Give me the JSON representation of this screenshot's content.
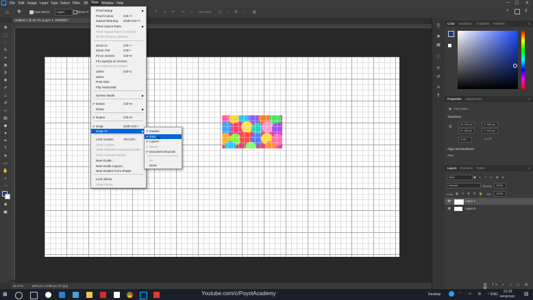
{
  "menubar": {
    "items": [
      "File",
      "Edit",
      "Image",
      "Layer",
      "Type",
      "Select",
      "Filter",
      "3D",
      "View",
      "Window",
      "Help"
    ],
    "window_controls": [
      "—",
      "☐",
      "✕"
    ]
  },
  "options": {
    "auto_select": "Auto-Select:",
    "layer_select": "Layer",
    "show_transform": "Show Tr",
    "mode_3d": "3D Mode:"
  },
  "document": {
    "tab_title": "Untitled-1 @ 66.7% (Layer 1, RGB/8#) *",
    "tab_close": "×"
  },
  "status": {
    "zoom": "66.67%",
    "doc_info": "1920 px x 1080 px (72 ppi)"
  },
  "view_menu": {
    "items": [
      {
        "label": "Proof Setup",
        "shortcut": "",
        "check": false,
        "disabled": false,
        "submenu": true
      },
      {
        "label": "Proof Colors",
        "shortcut": "Ctrl+Y",
        "check": false,
        "disabled": false,
        "submenu": false
      },
      {
        "label": "Gamut Warning",
        "shortcut": "Shift+Ctrl+Y",
        "check": false,
        "disabled": false,
        "submenu": false
      },
      {
        "label": "Pixel Aspect Ratio",
        "shortcut": "",
        "check": false,
        "disabled": false,
        "submenu": true
      },
      {
        "label": "Pixel Aspect Ratio Correction",
        "shortcut": "",
        "check": false,
        "disabled": true,
        "submenu": false
      },
      {
        "label": "32-bit Preview Options...",
        "shortcut": "",
        "check": false,
        "disabled": true,
        "submenu": false
      },
      {
        "label": "Zoom In",
        "shortcut": "Ctrl++",
        "check": false,
        "disabled": false,
        "submenu": false
      },
      {
        "label": "Zoom Out",
        "shortcut": "Ctrl+-",
        "check": false,
        "disabled": false,
        "submenu": false
      },
      {
        "label": "Fit on Screen",
        "shortcut": "Ctrl+0",
        "check": false,
        "disabled": false,
        "submenu": false
      },
      {
        "label": "Fit Layer(s) on Screen",
        "shortcut": "",
        "check": false,
        "disabled": false,
        "submenu": false
      },
      {
        "label": "Fit Artboard on Screen",
        "shortcut": "",
        "check": false,
        "disabled": true,
        "submenu": false
      },
      {
        "label": "100%",
        "shortcut": "Ctrl+1",
        "check": false,
        "disabled": false,
        "submenu": false
      },
      {
        "label": "200%",
        "shortcut": "",
        "check": false,
        "disabled": false,
        "submenu": false
      },
      {
        "label": "Print Size",
        "shortcut": "",
        "check": false,
        "disabled": false,
        "submenu": false
      },
      {
        "label": "Flip Horizontal",
        "shortcut": "",
        "check": false,
        "disabled": false,
        "submenu": false
      },
      {
        "label": "Screen Mode",
        "shortcut": "",
        "check": false,
        "disabled": false,
        "submenu": true
      },
      {
        "label": "Extras",
        "shortcut": "Ctrl+H",
        "check": true,
        "disabled": false,
        "submenu": false
      },
      {
        "label": "Show",
        "shortcut": "",
        "check": false,
        "disabled": false,
        "submenu": true
      },
      {
        "label": "Rulers",
        "shortcut": "Ctrl+R",
        "check": true,
        "disabled": false,
        "submenu": false
      },
      {
        "label": "Snap",
        "shortcut": "Shift+Ctrl+;",
        "check": true,
        "disabled": false,
        "submenu": false
      },
      {
        "label": "Snap To",
        "shortcut": "",
        "check": false,
        "disabled": false,
        "submenu": true,
        "highlight": true
      },
      {
        "label": "Lock Guides",
        "shortcut": "Alt+Ctrl+;",
        "check": false,
        "disabled": false,
        "submenu": false
      },
      {
        "label": "Clear Guides",
        "shortcut": "",
        "check": false,
        "disabled": true,
        "submenu": false
      },
      {
        "label": "Clear Selected Artboard Guides",
        "shortcut": "",
        "check": false,
        "disabled": true,
        "submenu": false
      },
      {
        "label": "Clear Canvas Guides",
        "shortcut": "",
        "check": false,
        "disabled": true,
        "submenu": false
      },
      {
        "label": "New Guide...",
        "shortcut": "",
        "check": false,
        "disabled": false,
        "submenu": false
      },
      {
        "label": "New Guide Layout...",
        "shortcut": "",
        "check": false,
        "disabled": false,
        "submenu": false
      },
      {
        "label": "New Guides From Shape",
        "shortcut": "",
        "check": false,
        "disabled": false,
        "submenu": false
      },
      {
        "label": "Lock Slices",
        "shortcut": "",
        "check": false,
        "disabled": false,
        "submenu": false
      },
      {
        "label": "Clear Slices",
        "shortcut": "",
        "check": false,
        "disabled": true,
        "submenu": false
      }
    ]
  },
  "snap_menu": {
    "items": [
      {
        "label": "Guides",
        "check": true,
        "disabled": false
      },
      {
        "label": "Grid",
        "check": true,
        "disabled": false,
        "highlight": true
      },
      {
        "label": "Layers",
        "check": true,
        "disabled": false
      },
      {
        "label": "Slices",
        "check": true,
        "disabled": true
      },
      {
        "label": "Document Bounds",
        "check": true,
        "disabled": false
      },
      {
        "label": "All",
        "check": false,
        "disabled": true
      },
      {
        "label": "None",
        "check": false,
        "disabled": false
      }
    ]
  },
  "color_panel": {
    "tabs": [
      "Color",
      "Swatches",
      "Gradients",
      "Patterns"
    ]
  },
  "properties_panel": {
    "tabs": [
      "Properties",
      "Adjustments"
    ],
    "layer_kind": "Pixel Layer",
    "transform_label": "Transform",
    "w": "W: 206 px",
    "h": "H: 182 px",
    "x": "X: 966 px",
    "y": "Y: 313 px",
    "angle": "0.00°",
    "align_label": "Align and Distribute",
    "align_sub": "Align:"
  },
  "layers_panel": {
    "tabs": [
      "Layers",
      "Channels",
      "Paths"
    ],
    "kind": "Kind",
    "blend": "Normal",
    "opacity_label": "Opacity:",
    "opacity": "100%",
    "lock_label": "Lock:",
    "fill_label": "Fill:",
    "fill": "100%",
    "layers": [
      "Layer 1",
      "Layer 0"
    ]
  },
  "taskbar": {
    "desktop": "Desktop",
    "lang": "ENG",
    "time": "21:33",
    "date": "19/09/2020",
    "watermark": "Youtube.com/c/PoyotAcademy"
  },
  "colors": {
    "highlight": "#0a64d8",
    "canvas_bg": "#ffffff",
    "ui_dark": "#323232"
  }
}
